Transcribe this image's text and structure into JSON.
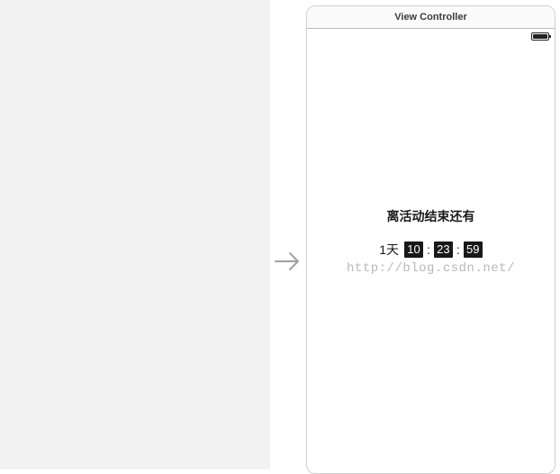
{
  "window": {
    "title": "View Controller"
  },
  "countdown": {
    "title": "离活动结束还有",
    "days_label": "1天",
    "hours": "10",
    "minutes": "23",
    "seconds": "59",
    "separator": ":"
  },
  "watermark": "http://blog.csdn.net/"
}
